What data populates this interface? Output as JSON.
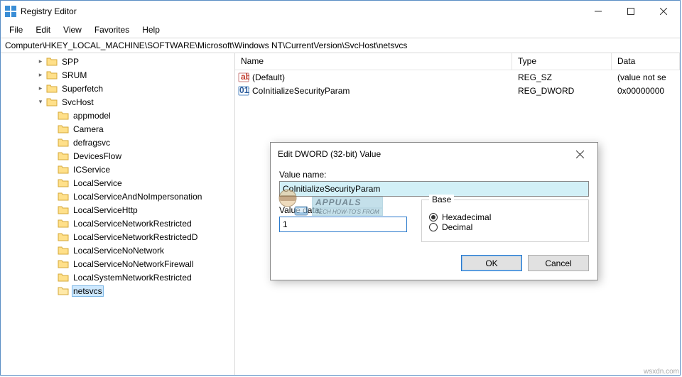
{
  "window": {
    "title": "Registry Editor"
  },
  "menu": {
    "file": "File",
    "edit": "Edit",
    "view": "View",
    "favorites": "Favorites",
    "help": "Help"
  },
  "path": "Computer\\HKEY_LOCAL_MACHINE\\SOFTWARE\\Microsoft\\Windows NT\\CurrentVersion\\SvcHost\\netsvcs",
  "tree": {
    "items": [
      {
        "level": 3,
        "exp": ">",
        "label": "SPP"
      },
      {
        "level": 3,
        "exp": ">",
        "label": "SRUM"
      },
      {
        "level": 3,
        "exp": ">",
        "label": "Superfetch"
      },
      {
        "level": 3,
        "exp": "v",
        "label": "SvcHost"
      },
      {
        "level": 4,
        "exp": "",
        "label": "appmodel"
      },
      {
        "level": 4,
        "exp": "",
        "label": "Camera"
      },
      {
        "level": 4,
        "exp": "",
        "label": "defragsvc"
      },
      {
        "level": 4,
        "exp": "",
        "label": "DevicesFlow"
      },
      {
        "level": 4,
        "exp": "",
        "label": "ICService"
      },
      {
        "level": 4,
        "exp": "",
        "label": "LocalService"
      },
      {
        "level": 4,
        "exp": "",
        "label": "LocalServiceAndNoImpersonation"
      },
      {
        "level": 4,
        "exp": "",
        "label": "LocalServiceHttp"
      },
      {
        "level": 4,
        "exp": "",
        "label": "LocalServiceNetworkRestricted"
      },
      {
        "level": 4,
        "exp": "",
        "label": "LocalServiceNetworkRestrictedD"
      },
      {
        "level": 4,
        "exp": "",
        "label": "LocalServiceNoNetwork"
      },
      {
        "level": 4,
        "exp": "",
        "label": "LocalServiceNoNetworkFirewall"
      },
      {
        "level": 4,
        "exp": "",
        "label": "LocalSystemNetworkRestricted"
      },
      {
        "level": 4,
        "exp": "",
        "label": "netsvcs",
        "selected": true
      }
    ]
  },
  "list": {
    "headers": {
      "name": "Name",
      "type": "Type",
      "data": "Data"
    },
    "rows": [
      {
        "icon": "sz",
        "name": "(Default)",
        "type": "REG_SZ",
        "data": "(value not se"
      },
      {
        "icon": "dw",
        "name": "CoInitializeSecurityParam",
        "type": "REG_DWORD",
        "data": "0x00000000"
      }
    ]
  },
  "dialog": {
    "title": "Edit DWORD (32-bit) Value",
    "value_name_label": "Value name:",
    "value_name": "CoInitializeSecurityParam",
    "value_data_label": "Value data:",
    "value_data": "1",
    "base_label": "Base",
    "radio_hex": "Hexadecimal",
    "radio_dec": "Decimal",
    "ok": "OK",
    "cancel": "Cancel"
  },
  "watermark": {
    "brand": "APPUALS",
    "tag": "TECH HOW-TO'S FROM",
    "site": "wsxdn.com"
  }
}
